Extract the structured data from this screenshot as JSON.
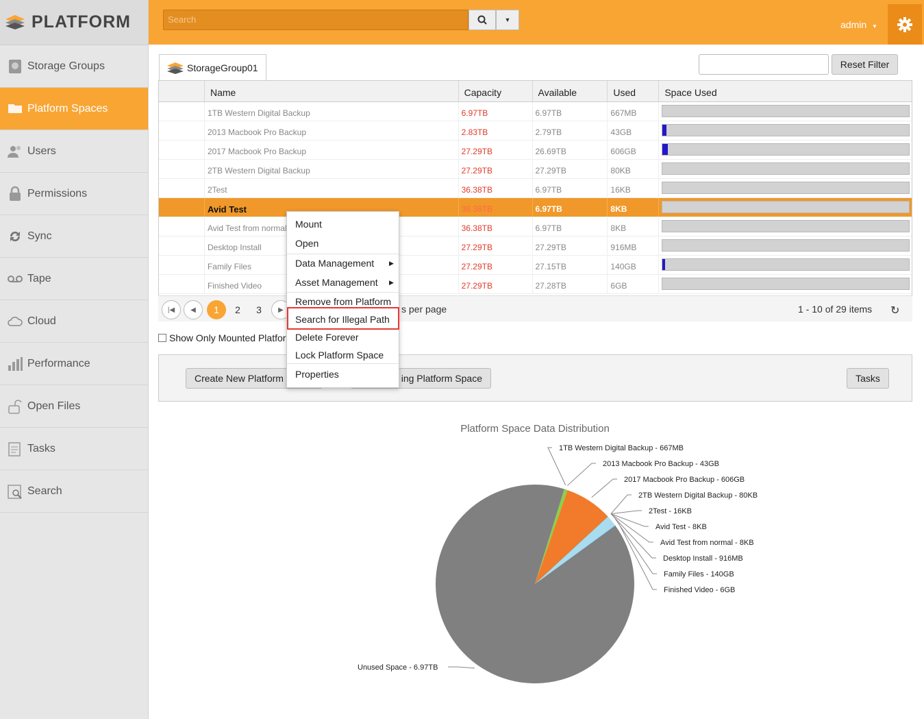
{
  "app": {
    "logo_text": "PLATFORM"
  },
  "sidebar": {
    "items": [
      {
        "label": "Storage Groups",
        "icon": "storage-icon",
        "active": false
      },
      {
        "label": "Platform Spaces",
        "icon": "folder-icon",
        "active": true
      },
      {
        "label": "Users",
        "icon": "users-icon",
        "active": false
      },
      {
        "label": "Permissions",
        "icon": "lock-icon",
        "active": false
      },
      {
        "label": "Sync",
        "icon": "sync-icon",
        "active": false
      },
      {
        "label": "Tape",
        "icon": "tape-icon",
        "active": false
      },
      {
        "label": "Cloud",
        "icon": "cloud-icon",
        "active": false
      },
      {
        "label": "Performance",
        "icon": "bar-chart-icon",
        "active": false
      },
      {
        "label": "Open Files",
        "icon": "open-lock-icon",
        "active": false
      },
      {
        "label": "Tasks",
        "icon": "tasks-icon",
        "active": false
      },
      {
        "label": "Search",
        "icon": "search-doc-icon",
        "active": false
      }
    ]
  },
  "topbar": {
    "search_placeholder": "Search",
    "user": "admin"
  },
  "tabs": {
    "storage_group": "StorageGroup01"
  },
  "filter": {
    "value": "",
    "reset_label": "Reset Filter"
  },
  "grid": {
    "columns": [
      "Name",
      "Capacity",
      "Available",
      "Used",
      "Space Used"
    ],
    "rows": [
      {
        "name": "1TB Western Digital Backup",
        "capacity": "6.97TB",
        "available": "6.97TB",
        "used": "667MB",
        "fill": 0
      },
      {
        "name": "2013 Macbook Pro Backup",
        "capacity": "2.83TB",
        "available": "2.79TB",
        "used": "43GB",
        "fill": 0.015
      },
      {
        "name": "2017 Macbook Pro Backup",
        "capacity": "27.29TB",
        "available": "26.69TB",
        "used": "606GB",
        "fill": 0.022
      },
      {
        "name": "2TB Western Digital Backup",
        "capacity": "27.29TB",
        "available": "27.29TB",
        "used": "80KB",
        "fill": 0
      },
      {
        "name": "2Test",
        "capacity": "36.38TB",
        "available": "6.97TB",
        "used": "16KB",
        "fill": 0
      },
      {
        "name": "Avid Test",
        "capacity": "36.38TB",
        "available": "6.97TB",
        "used": "8KB",
        "fill": 0,
        "selected": true
      },
      {
        "name": "Avid Test from normal",
        "capacity": "36.38TB",
        "available": "6.97TB",
        "used": "8KB",
        "fill": 0
      },
      {
        "name": "Desktop Install",
        "capacity": "27.29TB",
        "available": "27.29TB",
        "used": "916MB",
        "fill": 0
      },
      {
        "name": "Family Files",
        "capacity": "27.29TB",
        "available": "27.15TB",
        "used": "140GB",
        "fill": 0.005
      },
      {
        "name": "Finished Video",
        "capacity": "27.29TB",
        "available": "27.28TB",
        "used": "6GB",
        "fill": 0
      }
    ]
  },
  "pager": {
    "pages": [
      "1",
      "2",
      "3"
    ],
    "current": "1",
    "per_page_label": "s per page",
    "count": "1 - 10 of 29 items"
  },
  "options": {
    "show_mounted": "Show Only Mounted Platfor"
  },
  "actions": {
    "create": "Create New Platform",
    "existing": "ing Platform Space",
    "tasks": "Tasks"
  },
  "context_menu": {
    "items": [
      "Mount",
      "Open",
      "Data Management",
      "Asset Management",
      "Remove from Platform",
      "Search for Illegal Path",
      "Delete Forever",
      "Lock Platform Space",
      "Properties"
    ],
    "highlighted": "Search for Illegal Path"
  },
  "chart_data": {
    "type": "pie",
    "title": "Platform Space Data Distribution",
    "slices": [
      {
        "label": "1TB Western Digital Backup - 667MB",
        "value": 0.000667,
        "color": "#f27a2b"
      },
      {
        "label": "2013 Macbook Pro Backup - 43GB",
        "value": 0.043,
        "color": "#8ad146"
      },
      {
        "label": "2017 Macbook Pro Backup - 606GB",
        "value": 0.606,
        "color": "#f27a2b"
      },
      {
        "label": "2TB Western Digital Backup - 80KB",
        "value": 8e-08,
        "color": "#5b8ad8"
      },
      {
        "label": "2Test - 16KB",
        "value": 1.6e-08,
        "color": "#7c5ec8"
      },
      {
        "label": "Avid Test - 8KB",
        "value": 8e-09,
        "color": "#cc4f5e"
      },
      {
        "label": "Avid Test from normal - 8KB",
        "value": 8e-09,
        "color": "#4fbf9f"
      },
      {
        "label": "Desktop Install - 916MB",
        "value": 0.000916,
        "color": "#d9c23a"
      },
      {
        "label": "Family Files - 140GB",
        "value": 0.14,
        "color": "#a9dcee"
      },
      {
        "label": "Finished Video - 6GB",
        "value": 0.006,
        "color": "#4da6e8"
      },
      {
        "label": "Unused Space - 6.97TB",
        "value": 6.97,
        "color": "#808080"
      }
    ]
  }
}
